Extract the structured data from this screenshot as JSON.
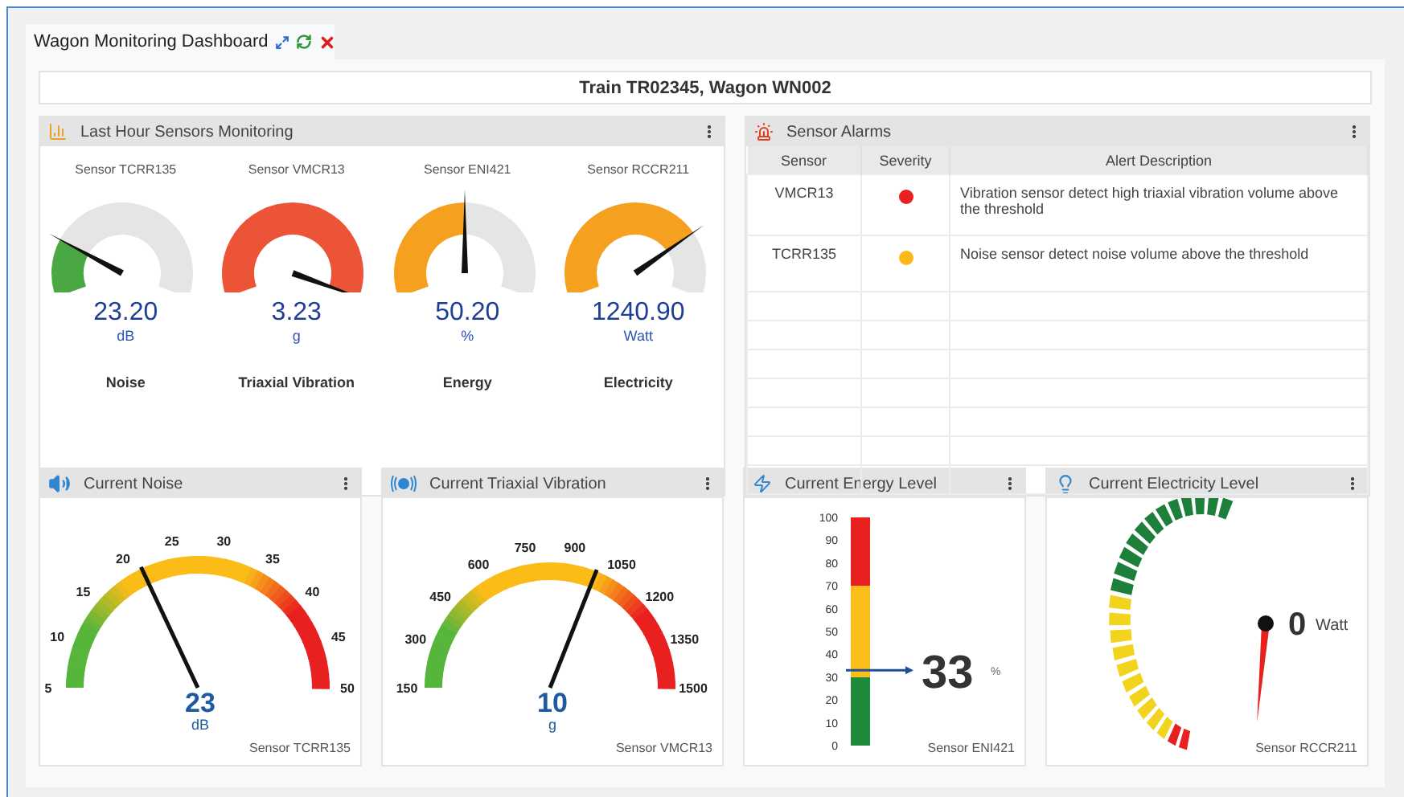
{
  "tab": {
    "title": "Wagon Monitoring Dashboard",
    "selected": true
  },
  "header": {
    "title": "Train TR02345, Wagon WN002"
  },
  "last_hour": {
    "title": "Last Hour Sensors Monitoring",
    "gauges": [
      {
        "sensor": "Sensor TCRR135",
        "value": "23.20",
        "unit": "dB",
        "name": "Noise",
        "color": "#4aa843"
      },
      {
        "sensor": "Sensor VMCR13",
        "value": "3.23",
        "unit": "g",
        "name": "Triaxial Vibration",
        "color": "#ec5437"
      },
      {
        "sensor": "Sensor ENI421",
        "value": "50.20",
        "unit": "%",
        "name": "Energy",
        "color": "#f5a01f"
      },
      {
        "sensor": "Sensor RCCR211",
        "value": "1240.90",
        "unit": "Watt",
        "name": "Electricity",
        "color": "#f5a01f"
      }
    ]
  },
  "alarms": {
    "title": "Sensor Alarms",
    "columns": [
      "Sensor",
      "Severity",
      "Alert Description"
    ],
    "rows": [
      {
        "sensor": "VMCR13",
        "color": "#e8201f",
        "description": "Vibration sensor detect high triaxial vibration volume above the threshold"
      },
      {
        "sensor": "TCRR135",
        "color": "#fbb917",
        "description": "Noise sensor detect noise volume above the threshold"
      }
    ]
  },
  "current": [
    {
      "kind": "dial",
      "title": "Current Noise",
      "ticks": [
        "5",
        "10",
        "15",
        "20",
        "25",
        "30",
        "35",
        "40",
        "45",
        "50"
      ],
      "value": "23",
      "unit": "dB",
      "sensor": "Sensor TCRR135"
    },
    {
      "kind": "dial",
      "title": "Current Triaxial Vibration",
      "ticks": [
        "150",
        "300",
        "450",
        "600",
        "750",
        "900",
        "1050",
        "1200",
        "1350",
        "1500"
      ],
      "value": "10",
      "unit": "g",
      "sensor": "Sensor VMCR13"
    },
    {
      "kind": "bar",
      "title": "Current Energy Level",
      "ticks": [
        "100",
        "90",
        "80",
        "70",
        "60",
        "50",
        "40",
        "30",
        "20",
        "10",
        "0"
      ],
      "value": "33",
      "unit": "%",
      "sensor": "Sensor ENI421"
    },
    {
      "kind": "segments",
      "title": "Current Electricity Level",
      "value": "0",
      "unit": "Watt",
      "sensor": "Sensor RCCR211"
    }
  ]
}
